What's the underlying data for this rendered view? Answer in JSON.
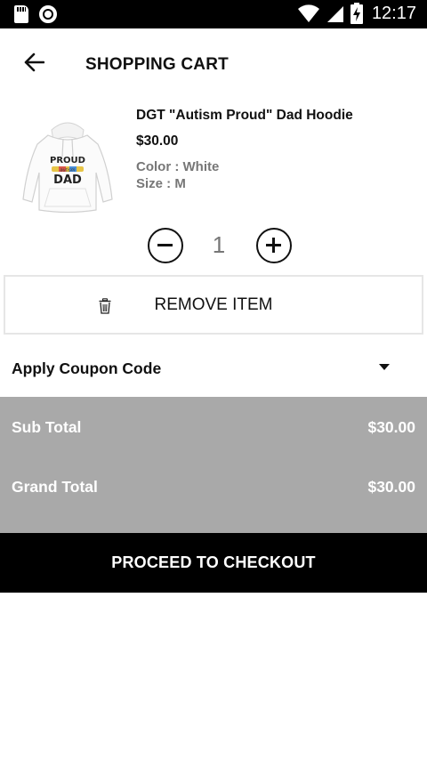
{
  "status_bar": {
    "time": "12:17",
    "icons": [
      "sd-card-icon",
      "circle-notification-icon",
      "wifi-icon",
      "signal-icon",
      "battery-charging-icon"
    ]
  },
  "header": {
    "title": "SHOPPING CART",
    "back_icon": "back-arrow-icon"
  },
  "cart_item": {
    "name": "DGT \"Autism Proud\" Dad Hoodie",
    "price": "$30.00",
    "color": "Color : White",
    "size": "Size : M",
    "image_icon": "hoodie-product-image",
    "image_text": [
      "PROUD",
      "autism",
      "DAD"
    ],
    "quantity": "1"
  },
  "remove": {
    "label": "REMOVE ITEM",
    "icon": "trash-icon"
  },
  "coupon": {
    "label": "Apply Coupon Code",
    "icon": "caret-down-icon"
  },
  "totals": {
    "sub_total_label": "Sub Total",
    "sub_total_value": "$30.00",
    "grand_total_label": "Grand Total",
    "grand_total_value": "$30.00"
  },
  "checkout": {
    "label": "PROCEED TO CHECKOUT"
  },
  "colors": {
    "status_bar": "#000000",
    "totals_background": "#a9a9a9",
    "checkout_background": "#000000",
    "secondary_text": "#777777"
  }
}
